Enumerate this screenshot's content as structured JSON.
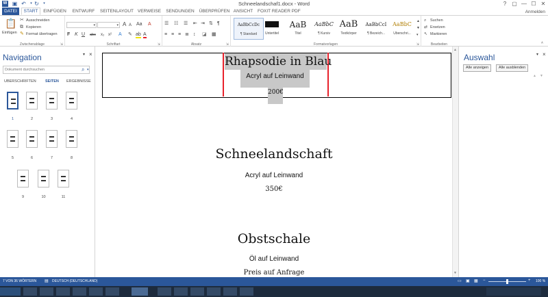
{
  "window": {
    "title": "Schneelandschaf1.docx - Word",
    "controls": [
      "?",
      "▢",
      "—",
      "☐",
      "✕"
    ]
  },
  "quick_access": {
    "save_icon": "save-icon",
    "undo_icon": "undo-icon",
    "redo_icon": "redo-icon"
  },
  "tabs": [
    "DATEI",
    "START",
    "EINFÜGEN",
    "ENTWURF",
    "SEITENLAYOUT",
    "VERWEISE",
    "SENDUNGEN",
    "ÜBERPRÜFEN",
    "ANSICHT",
    "FOXIT READER PDF"
  ],
  "signin": "Anmelden",
  "ribbon": {
    "clipboard": {
      "paste": "Einfügen",
      "cut": "Ausschneiden",
      "copy": "Kopieren",
      "format_painter": "Format übertragen",
      "label": "Zwischenablage"
    },
    "font": {
      "bold": "F",
      "italic": "K",
      "underline": "U",
      "strike": "abc",
      "sub": "x₂",
      "sup": "x²",
      "grow": "A",
      "shrink": "A",
      "case": "Aa",
      "clear": "A",
      "label": "Schriftart"
    },
    "paragraph": {
      "label": "Absatz"
    },
    "styles": {
      "items": [
        {
          "preview": "AaBbCcDc",
          "label": "¶ Standard"
        },
        {
          "preview": "AaBbCcDc",
          "label": "Untertitel"
        },
        {
          "preview": "AaB",
          "label": "Titel"
        },
        {
          "preview": "AaBbC",
          "label": "¶ Kursiv"
        },
        {
          "preview": "AaB",
          "label": "Textkörper"
        },
        {
          "preview": "AaBbCcI",
          "label": "¶ Bezeich..."
        },
        {
          "preview": "AaBbC",
          "label": "Überschri..."
        }
      ],
      "label": "Formatvorlagen"
    },
    "editing": {
      "find": "Suchen",
      "replace": "Ersetzen",
      "select": "Markieren",
      "label": "Bearbeiten"
    }
  },
  "nav": {
    "title": "Navigation",
    "search_placeholder": "Dokument durchsuchen",
    "tabs": [
      "ÜBERSCHRIFTEN",
      "SEITEN",
      "ERGEBNISSE"
    ],
    "pages": [
      "1",
      "2",
      "3",
      "4",
      "5",
      "6",
      "7",
      "8",
      "9",
      "10",
      "11"
    ]
  },
  "selection_pane": {
    "title": "Auswahl",
    "show_all": "Alle anzeigen",
    "hide_all": "Alle ausblenden"
  },
  "document": {
    "block1": {
      "title": "Rhapsodie in Blau",
      "medium": "Acryl auf Leinwand",
      "price": "200€"
    },
    "block2": {
      "title": "Schneelandschaft",
      "medium": "Acryl auf Leinwand",
      "price": "350€"
    },
    "block3": {
      "title": "Obstschale",
      "medium": "Öl auf Leinwand",
      "price": "Preis auf Anfrage"
    }
  },
  "status": {
    "words": "7 VON 36 WÖRTERN",
    "language": "DEUTSCH (DEUTSCHLAND)",
    "zoom": "100 %"
  },
  "colors": {
    "accent": "#2b579a",
    "highlight": "#c8c8c8",
    "red_line": "#e8202a"
  }
}
